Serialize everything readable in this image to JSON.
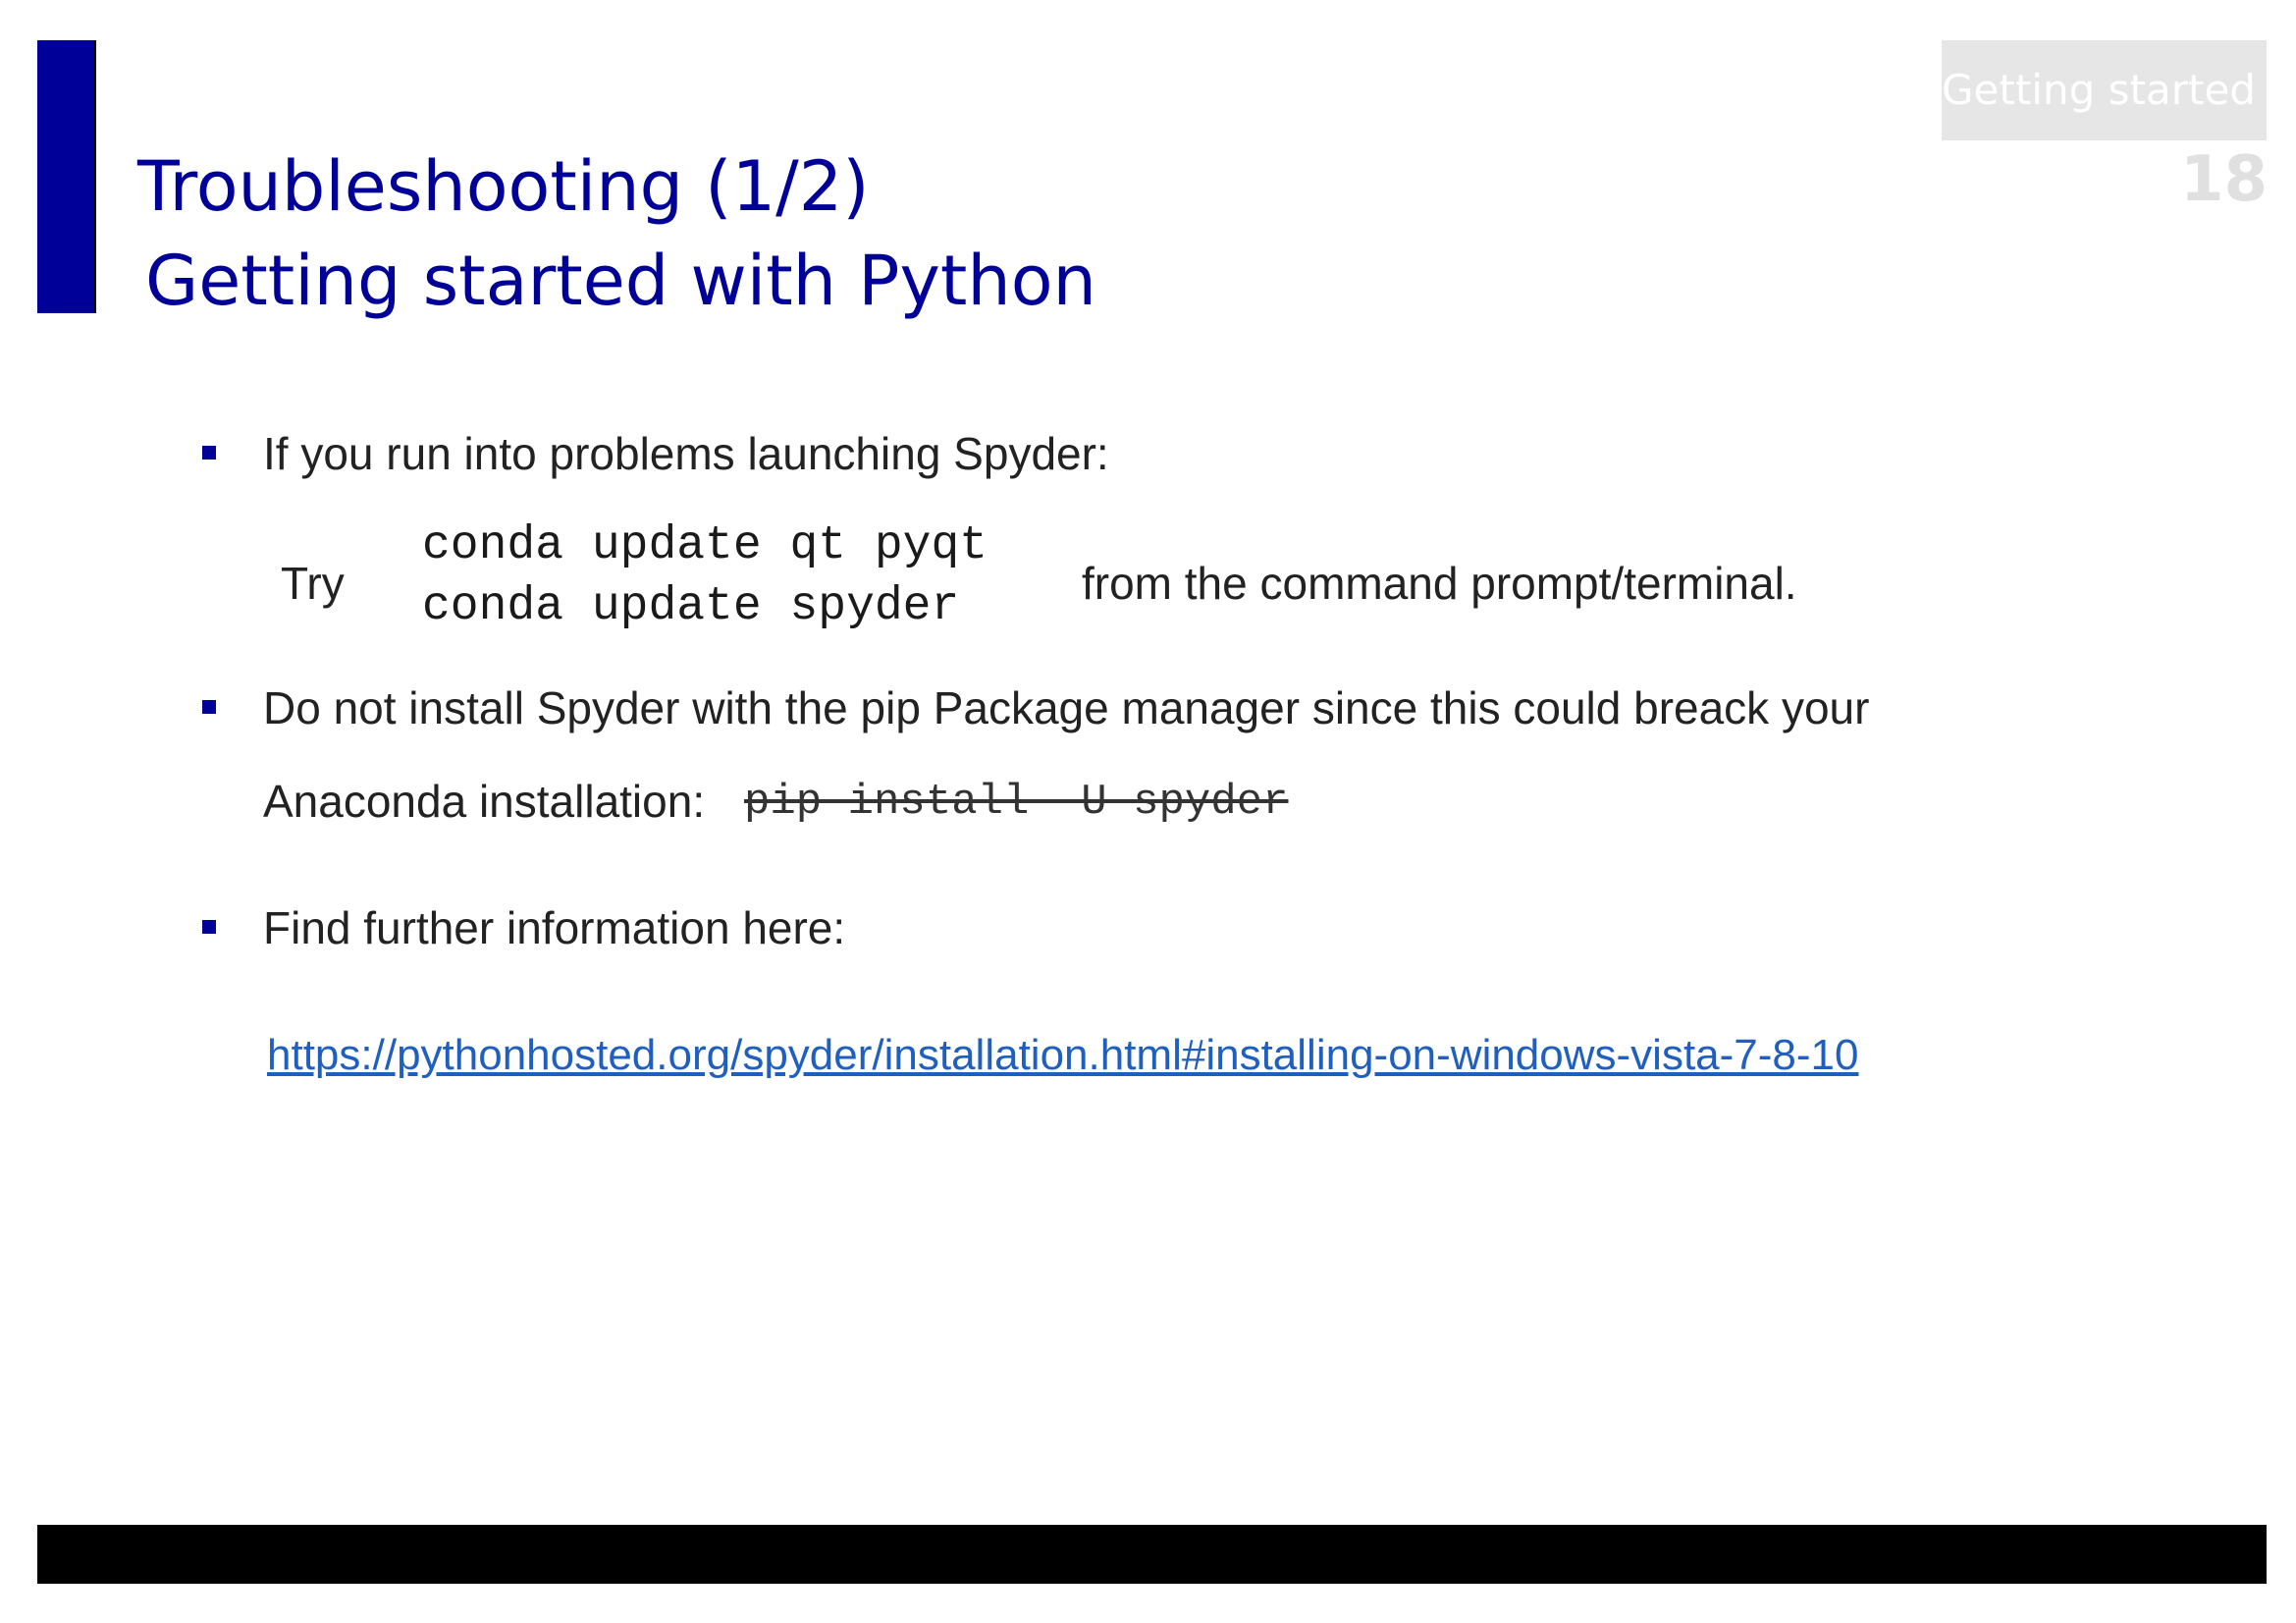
{
  "header": {
    "title_line1": "Troubleshooting (1/2)",
    "title_line2": "Getting started with Python",
    "section_tag": "Getting started",
    "page_number": "18"
  },
  "bullets": [
    {
      "text": "If you run into problems launching Spyder:",
      "try_label": "Try",
      "commands": [
        "conda update qt pyqt",
        "conda update spyder"
      ],
      "suffix": "from the command prompt/terminal."
    },
    {
      "text_line1": "Do not install Spyder with the pip Package manager since this could breack your",
      "text_line2": "Anaconda installation:",
      "struck_command": "pip install -U spyder"
    },
    {
      "text": "Find further information here:",
      "link": "https://pythonhosted.org/spyder/installation.html#installing-on-windows-vista-7-8-10"
    }
  ],
  "colors": {
    "accent": "#000099",
    "link": "#1f5fbf",
    "footer": "#000000"
  }
}
